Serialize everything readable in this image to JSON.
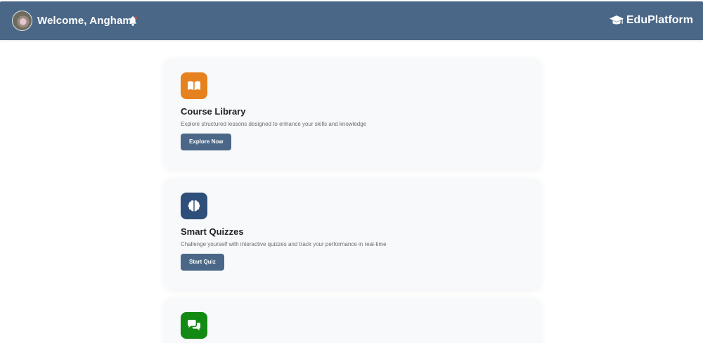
{
  "header": {
    "welcome": "Welcome, Angham",
    "brand": "EduPlatform",
    "avatar_icon": "user-avatar",
    "bell_icon": "bell-icon",
    "brand_icon": "graduation-cap-icon",
    "color": "#4a6787"
  },
  "cards": [
    {
      "title": "Course Library",
      "description": "Explore structured lessons designed to enhance your skills and knowledge",
      "button": "Explore Now",
      "icon": "book-open-icon",
      "icon_color": "#e6811f"
    },
    {
      "title": "Smart Quizzes",
      "description": "Challenge yourself with interactive quizzes and track your performance in real-time",
      "button": "Start Quiz",
      "icon": "brain-icon",
      "icon_color": "#2e4f7a"
    },
    {
      "icon": "comments-icon",
      "icon_color": "#138a13"
    }
  ]
}
